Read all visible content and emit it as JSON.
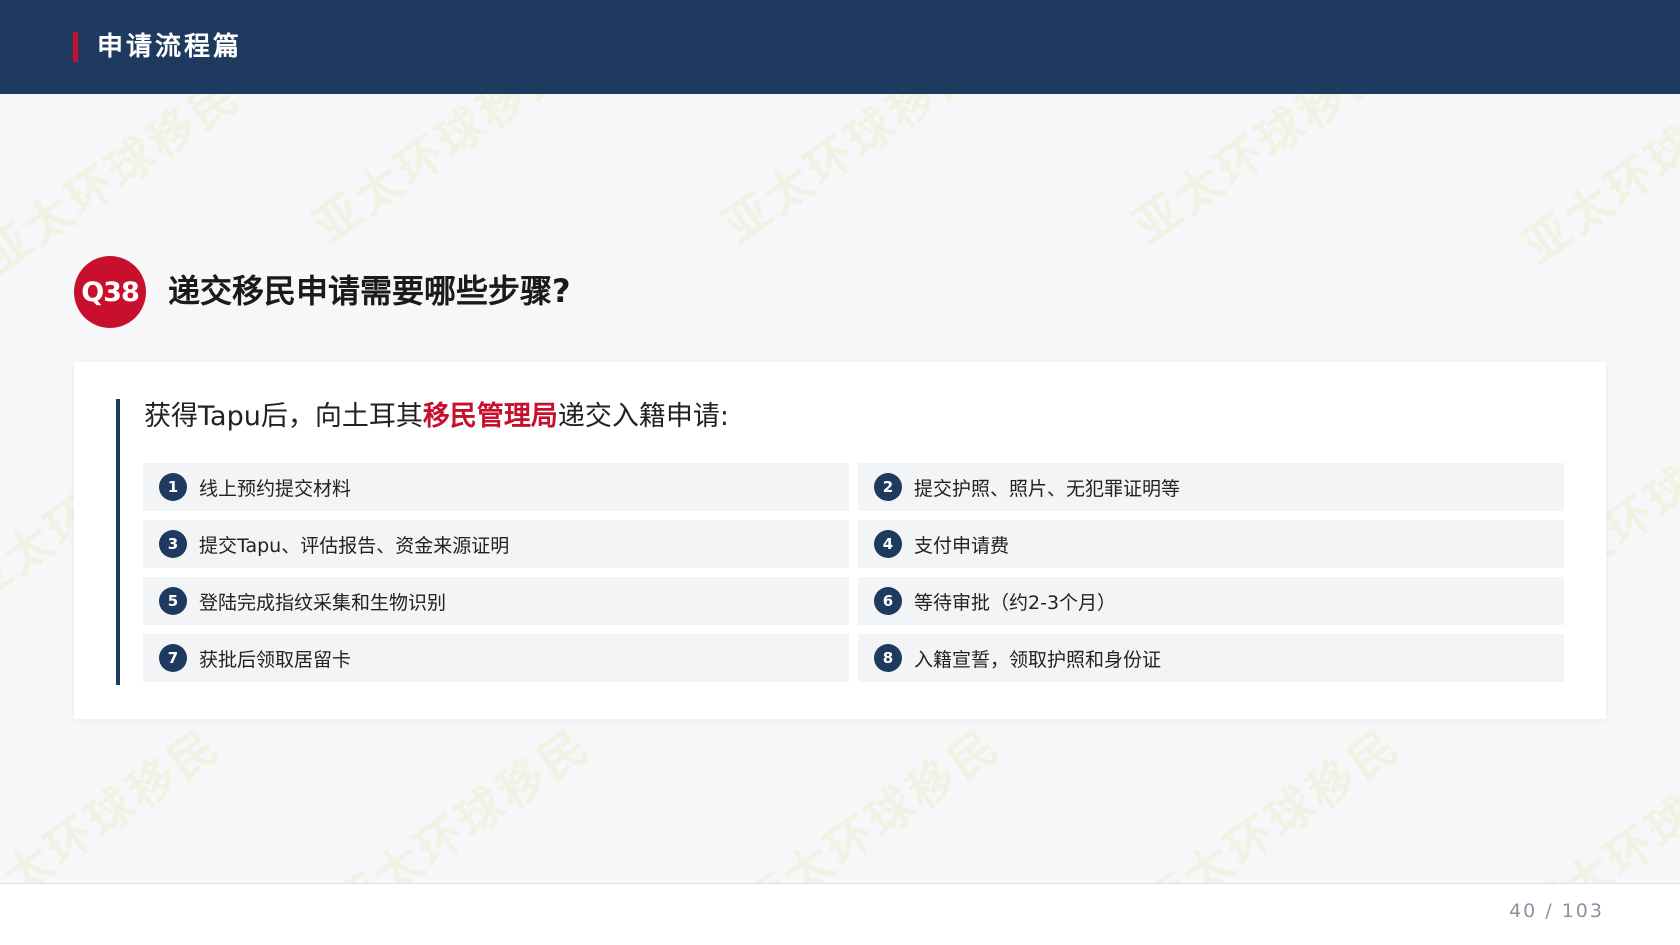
{
  "header": {
    "title": "申请流程篇"
  },
  "watermark": {
    "text": "亚太环球移民"
  },
  "question": {
    "badge": "Q38",
    "title": "递交移民申请需要哪些步骤?"
  },
  "card": {
    "intro_before": "获得Tapu后，向土耳其",
    "intro_highlight": "移民管理局",
    "intro_after": "递交入籍申请:",
    "steps": [
      {
        "num": "1",
        "text": "线上预约提交材料"
      },
      {
        "num": "2",
        "text": "提交护照、照片、无犯罪证明等"
      },
      {
        "num": "3",
        "text": "提交Tapu、评估报告、资金来源证明"
      },
      {
        "num": "4",
        "text": "支付申请费"
      },
      {
        "num": "5",
        "text": "登陆完成指纹采集和生物识别"
      },
      {
        "num": "6",
        "text": "等待审批（约2-3个月）"
      },
      {
        "num": "7",
        "text": "获批后领取居留卡"
      },
      {
        "num": "8",
        "text": "入籍宣誓，领取护照和身份证"
      }
    ]
  },
  "footer": {
    "page": "40 / 103"
  },
  "colors": {
    "navy": "#1f3a5f",
    "accent_red": "#c8102e"
  }
}
